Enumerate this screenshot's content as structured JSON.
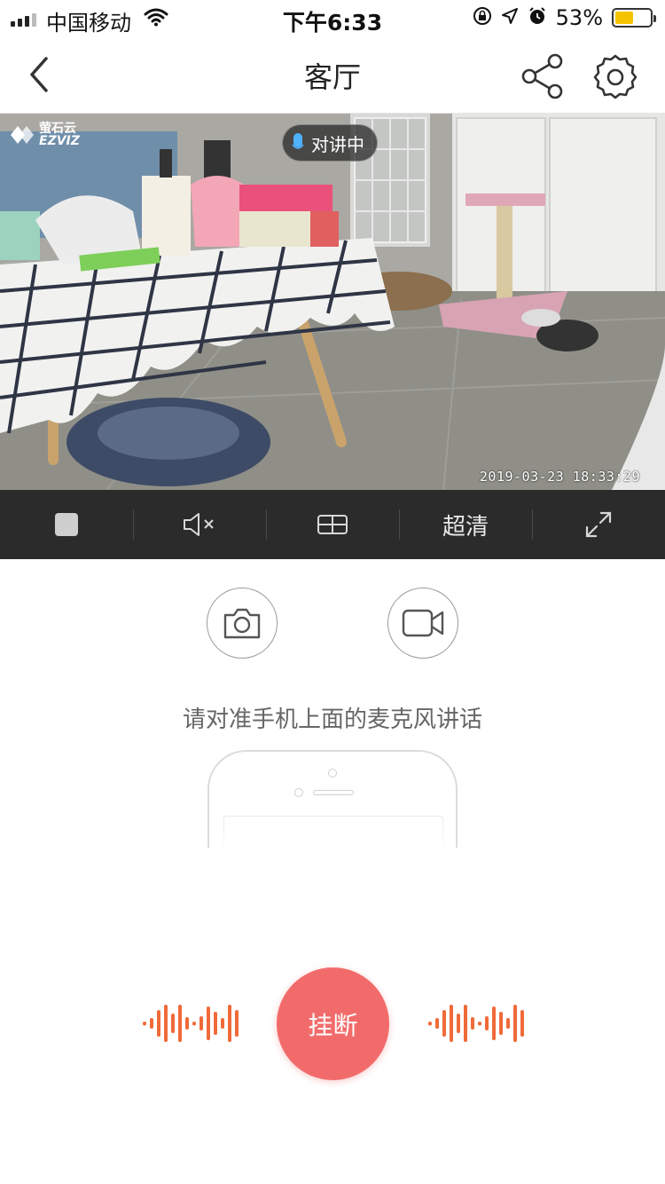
{
  "status_bar": {
    "carrier": "中国移动",
    "time": "下午6:33",
    "battery_percent": "53%",
    "battery_level": 0.53,
    "icons": [
      "signal-icon",
      "wifi-icon",
      "orientation-lock-icon",
      "location-icon",
      "alarm-icon",
      "battery-icon"
    ]
  },
  "nav": {
    "title": "客厅",
    "back_icon": "chevron-left-icon",
    "share_icon": "share-icon",
    "settings_icon": "settings-gear-icon"
  },
  "video": {
    "brand_cn": "萤石云",
    "brand_en": "EZVIZ",
    "intercom_status": "对讲中",
    "timestamp": "2019-03-23 18:33:29"
  },
  "controls": {
    "stop_icon": "stop-icon",
    "mute_icon": "speaker-muted-icon",
    "layout_icon": "grid-icon",
    "quality": "超清",
    "fullscreen_icon": "fullscreen-icon"
  },
  "actions": {
    "snapshot_icon": "camera-icon",
    "record_icon": "video-record-icon"
  },
  "hint": "请对准手机上面的麦克风讲话",
  "hangup_label": "挂断",
  "colors": {
    "accent": "#f26b6b",
    "wave": "#f06a3a",
    "control_bar": "#2b2b2b"
  }
}
